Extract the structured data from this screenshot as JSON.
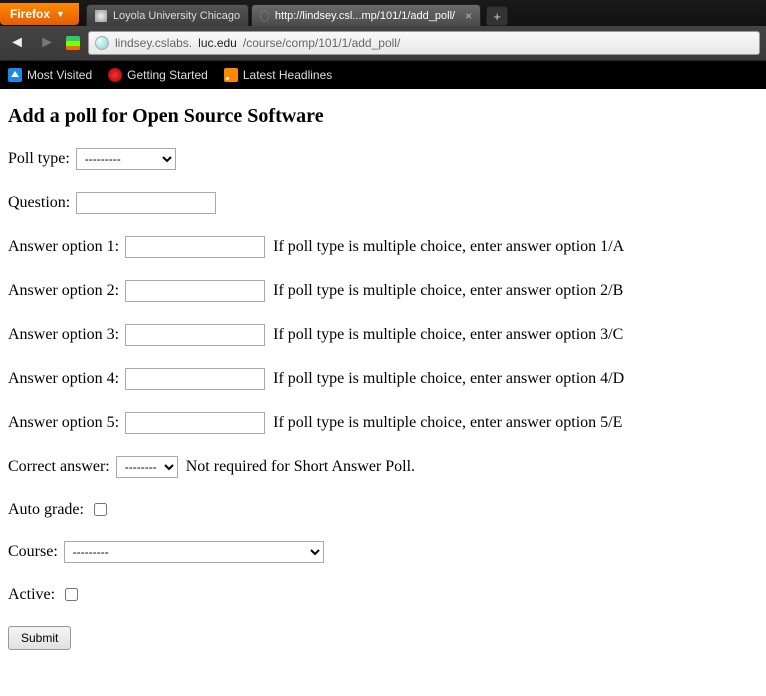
{
  "browser": {
    "app_button": "Firefox",
    "tabs": [
      {
        "label": "Loyola University Chicago",
        "active": false
      },
      {
        "label": "http://lindsey.csl...mp/101/1/add_poll/",
        "active": true
      }
    ],
    "url_display_prefix": "lindsey.cslabs.",
    "url_display_host": "luc.edu",
    "url_display_suffix": "/course/comp/101/1/add_poll/",
    "bookmarks": [
      {
        "label": "Most Visited"
      },
      {
        "label": "Getting Started"
      },
      {
        "label": "Latest Headlines"
      }
    ]
  },
  "page": {
    "heading": "Add a poll for Open Source Software",
    "poll_type_label": "Poll type:",
    "poll_type_value": "---------",
    "question_label": "Question:",
    "question_value": "",
    "answers": [
      {
        "label": "Answer option 1:",
        "value": "",
        "hint": "If poll type is multiple choice, enter answer option 1/A"
      },
      {
        "label": "Answer option 2:",
        "value": "",
        "hint": "If poll type is multiple choice, enter answer option 2/B"
      },
      {
        "label": "Answer option 3:",
        "value": "",
        "hint": "If poll type is multiple choice, enter answer option 3/C"
      },
      {
        "label": "Answer option 4:",
        "value": "",
        "hint": "If poll type is multiple choice, enter answer option 4/D"
      },
      {
        "label": "Answer option 5:",
        "value": "",
        "hint": "If poll type is multiple choice, enter answer option 5/E"
      }
    ],
    "correct_label": "Correct answer:",
    "correct_value": "---------",
    "correct_hint": "Not required for Short Answer Poll.",
    "autograde_label": "Auto grade:",
    "course_label": "Course:",
    "course_value": "---------",
    "active_label": "Active:",
    "submit_label": "Submit"
  }
}
